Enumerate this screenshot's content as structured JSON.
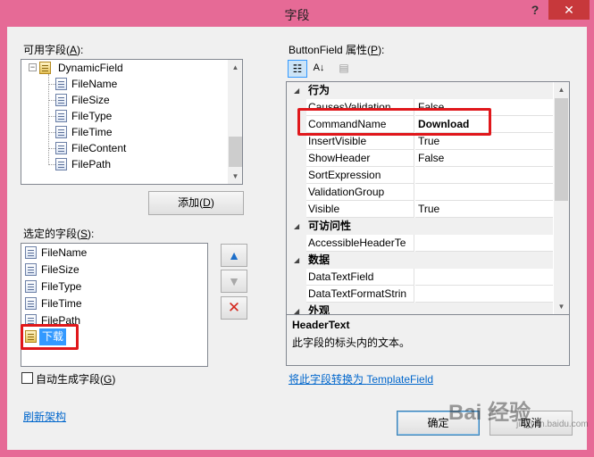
{
  "window": {
    "title": "字段",
    "help_glyph": "?",
    "close_glyph": "✕"
  },
  "available": {
    "label_prefix": "可用字段(",
    "label_key": "A",
    "label_suffix": "):",
    "root": "DynamicField",
    "items": [
      "FileName",
      "FileSize",
      "FileType",
      "FileTime",
      "FileContent",
      "FilePath"
    ]
  },
  "add_button": {
    "prefix": "添加(",
    "key": "D",
    "suffix": ")"
  },
  "selected": {
    "label_prefix": "选定的字段(",
    "label_key": "S",
    "label_suffix": "):",
    "items": [
      "FileName",
      "FileSize",
      "FileType",
      "FileTime",
      "FilePath"
    ],
    "active_item": "下载"
  },
  "move_buttons": {
    "up": "▲",
    "down": "▼",
    "delete": "✕"
  },
  "auto_generate": {
    "prefix": "自动生成字段(",
    "key": "G",
    "suffix": ")"
  },
  "refresh_link": "刷新架构",
  "props": {
    "label_prefix": "ButtonField 属性(",
    "label_key": "P",
    "label_suffix": "):",
    "toolbar": {
      "categorized": "☷",
      "alphabetical": "A↓",
      "pages": "▤"
    },
    "categories": [
      {
        "name": "行为",
        "rows": [
          {
            "name": "CausesValidation",
            "value": "False"
          },
          {
            "name": "CommandName",
            "value": "Download"
          },
          {
            "name": "InsertVisible",
            "value": "True"
          },
          {
            "name": "ShowHeader",
            "value": "False"
          },
          {
            "name": "SortExpression",
            "value": ""
          },
          {
            "name": "ValidationGroup",
            "value": ""
          },
          {
            "name": "Visible",
            "value": "True"
          }
        ]
      },
      {
        "name": "可访问性",
        "rows": [
          {
            "name": "AccessibleHeaderTe",
            "value": ""
          }
        ]
      },
      {
        "name": "数据",
        "rows": [
          {
            "name": "DataTextField",
            "value": ""
          },
          {
            "name": "DataTextFormatStrin",
            "value": ""
          }
        ]
      },
      {
        "name": "外观",
        "rows": []
      }
    ]
  },
  "description": {
    "title": "HeaderText",
    "text": "此字段的标头内的文本。"
  },
  "convert_link": {
    "prefix": "将此字段转换为 ",
    "target": "TemplateField"
  },
  "ok_button": "确定",
  "cancel_button": "取消",
  "watermark": {
    "text": "Bai 经验",
    "sub": "jingyan.baidu.com"
  },
  "colors": {
    "titlebar": "#e66a96",
    "close": "#c7383b",
    "highlight": "#e0171b",
    "selection": "#3399ff",
    "link": "#0066cc"
  }
}
